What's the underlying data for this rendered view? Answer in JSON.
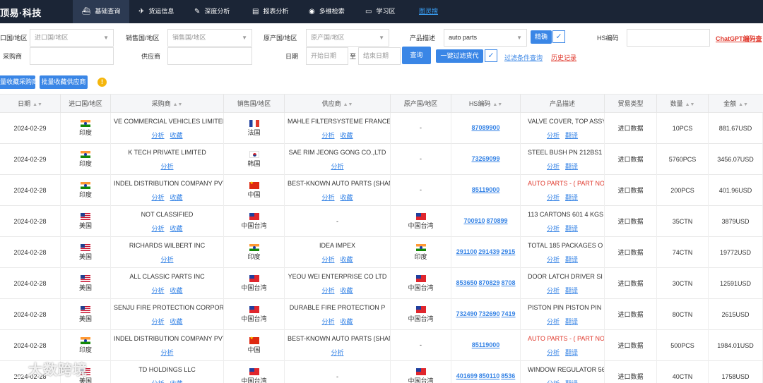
{
  "topbar": {
    "logo": "顶易·科技",
    "nav": [
      {
        "label": "基础查询",
        "icon": "ship-icon",
        "glyph": "⛴"
      },
      {
        "label": "货运信息",
        "icon": "plane-icon",
        "glyph": "✈"
      },
      {
        "label": "深度分析",
        "icon": "wand-icon",
        "glyph": "✎"
      },
      {
        "label": "报表分析",
        "icon": "chart-icon",
        "glyph": "📈"
      },
      {
        "label": "多维检索",
        "icon": "eye-icon",
        "glyph": "◉"
      },
      {
        "label": "学习区",
        "icon": "book-icon",
        "glyph": "📖"
      }
    ],
    "extra_link": "图灵搜"
  },
  "filters": {
    "import_country_label": "口国/地区",
    "import_country_placeholder": "进口国/地区",
    "sales_country_label": "销售国/地区",
    "sales_country_placeholder": "销售国/地区",
    "origin_country_label": "原产国/地区",
    "origin_country_placeholder": "原产国/地区",
    "product_label": "产品描述",
    "product_value": "auto parts",
    "exact_button": "精确",
    "hs_label": "HS编码",
    "chatgpt_link": "ChatGPT编码查",
    "buyer_label": "采购商",
    "supplier_label": "供应商",
    "date_label": "日期",
    "start_date_placeholder": "开始日期",
    "date_to": "至",
    "end_date_placeholder": "结束日期",
    "search_button": "查询",
    "oneclick_button": "一键过滤货代",
    "filter_link": "过滤条件查询",
    "history_link": "历史记录"
  },
  "actions": {
    "batch_buyer": "量收藏采购商",
    "batch_supplier": "批量收藏供应商",
    "tip": "!"
  },
  "table": {
    "headers": [
      "日期",
      "进口国/地区",
      "采购商",
      "销售国/地区",
      "供应商",
      "原产国/地区",
      "HS编码",
      "产品描述",
      "贸易类型",
      "数量",
      "金额"
    ],
    "analyze": "分析",
    "collect": "收藏",
    "translate": "翻译",
    "rows": [
      {
        "date": "2024-02-29",
        "imp_flag": "in",
        "imp": "印度",
        "buyer": "VE COMMERCIAL VEHICLES LIMITED",
        "buyer_collect": true,
        "sale_flag": "fr",
        "sale": "法国",
        "supplier": "MAHLE FILTERSYSTEME FRANCE",
        "supplier_collect": true,
        "origin_flag": "",
        "origin": "-",
        "hs": [
          "87089900"
        ],
        "desc": "VALVE COVER, TOP ASSY",
        "desc_red": false,
        "trade": "进口数据",
        "qty": "10PCS",
        "amount": "881.67USD"
      },
      {
        "date": "2024-02-29",
        "imp_flag": "in",
        "imp": "印度",
        "buyer": "K TECH PRIVATE LIMITED",
        "buyer_collect": false,
        "sale_flag": "kr",
        "sale": "韩国",
        "supplier": "SAE RIM JEONG GONG CO.,LTD",
        "supplier_collect": false,
        "origin_flag": "",
        "origin": "-",
        "hs": [
          "73269099"
        ],
        "desc": "STEEL BUSH PN 212BS1",
        "desc_red": false,
        "trade": "进口数据",
        "qty": "5760PCS",
        "amount": "3456.07USD"
      },
      {
        "date": "2024-02-28",
        "imp_flag": "in",
        "imp": "印度",
        "buyer": "INDEL DISTRIBUTION COMPANY PVT",
        "buyer_collect": true,
        "sale_flag": "cn",
        "sale": "中国",
        "supplier": "BEST-KNOWN AUTO PARTS (SHANGHAI)",
        "supplier_collect": true,
        "origin_flag": "",
        "origin": "-",
        "hs": [
          "85119000"
        ],
        "desc": "AUTO PARTS - ( PART NO",
        "desc_red": true,
        "trade": "进口数据",
        "qty": "200PCS",
        "amount": "401.96USD"
      },
      {
        "date": "2024-02-28",
        "imp_flag": "us",
        "imp": "美国",
        "buyer": "NOT CLASSIFIED",
        "buyer_collect": true,
        "sale_flag": "tw",
        "sale": "中国台湾",
        "supplier": "-",
        "supplier_collect": false,
        "supplier_dash": true,
        "origin_flag": "tw",
        "origin": "中国台湾",
        "hs": [
          "700910",
          "870899"
        ],
        "desc": "113 CARTONS 601 4 KGS",
        "desc_red": false,
        "trade": "进口数据",
        "qty": "35CTN",
        "amount": "3879USD"
      },
      {
        "date": "2024-02-28",
        "imp_flag": "us",
        "imp": "美国",
        "buyer": "RICHARDS WILBERT INC",
        "buyer_collect": false,
        "sale_flag": "in",
        "sale": "印度",
        "supplier": "IDEA IMPEX",
        "supplier_collect": true,
        "origin_flag": "in",
        "origin": "印度",
        "hs": [
          "291100",
          "291439",
          "2915"
        ],
        "desc": "TOTAL 185 PACKAGES O",
        "desc_red": false,
        "trade": "进口数据",
        "qty": "74CTN",
        "amount": "19772USD"
      },
      {
        "date": "2024-02-28",
        "imp_flag": "us",
        "imp": "美国",
        "buyer": "ALL CLASSIC PARTS INC",
        "buyer_collect": true,
        "sale_flag": "tw",
        "sale": "中国台湾",
        "supplier": "YEOU WEI ENTERPRISE CO LTD",
        "supplier_collect": true,
        "origin_flag": "tw",
        "origin": "中国台湾",
        "hs": [
          "853650",
          "870829",
          "8708"
        ],
        "desc": "DOOR LATCH DRIVER SI",
        "desc_red": false,
        "trade": "进口数据",
        "qty": "30CTN",
        "amount": "12591USD"
      },
      {
        "date": "2024-02-28",
        "imp_flag": "us",
        "imp": "美国",
        "buyer": "SENJU FIRE PROTECTION CORPORATION",
        "buyer_collect": true,
        "sale_flag": "tw",
        "sale": "中国台湾",
        "supplier": "DURABLE FIRE PROTECTION P",
        "supplier_collect": true,
        "origin_flag": "tw",
        "origin": "中国台湾",
        "hs": [
          "732490",
          "732690",
          "7419"
        ],
        "desc": "PISTON PIN PISTON PIN",
        "desc_red": false,
        "trade": "进口数据",
        "qty": "80CTN",
        "amount": "2615USD"
      },
      {
        "date": "2024-02-28",
        "imp_flag": "in",
        "imp": "印度",
        "buyer": "INDEL DISTRIBUTION COMPANY PVT",
        "buyer_collect": false,
        "sale_flag": "cn",
        "sale": "中国",
        "supplier": "BEST-KNOWN AUTO PARTS (SHANGHAI)",
        "supplier_collect": false,
        "origin_flag": "",
        "origin": "-",
        "hs": [
          "85119000"
        ],
        "desc": "AUTO PARTS - ( PART NO",
        "desc_red": true,
        "trade": "进口数据",
        "qty": "500PCS",
        "amount": "1984.01USD"
      },
      {
        "date": "2024-02-28",
        "imp_flag": "us",
        "imp": "美国",
        "buyer": "TD HOLDINGS LLC",
        "buyer_collect": true,
        "sale_flag": "tw",
        "sale": "中国台湾",
        "supplier": "-",
        "supplier_collect": false,
        "supplier_dash": true,
        "origin_flag": "tw",
        "origin": "中国台湾",
        "hs": [
          "401699",
          "850110",
          "8536"
        ],
        "desc": "WINDOW REGULATOR 56",
        "desc_red": false,
        "trade": "进口数据",
        "qty": "40CTN",
        "amount": "1758USD"
      }
    ]
  },
  "watermark": "大数跨境",
  "colors": {
    "topbar": "#1b2536",
    "accent": "#3a86e6",
    "link": "#3a86e6",
    "red": "#e0392d",
    "orange": "#f5b60c"
  }
}
